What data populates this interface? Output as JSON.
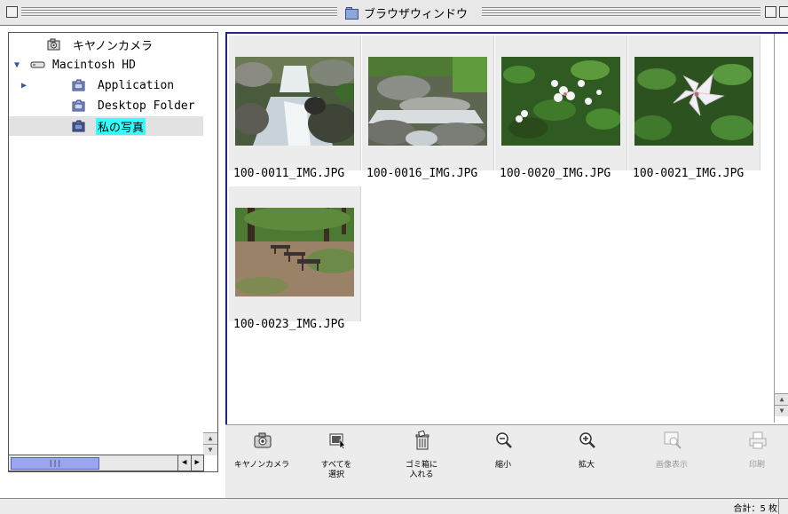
{
  "window": {
    "title": "ブラウザウィンドウ"
  },
  "tree": [
    {
      "label": "キヤノンカメラ",
      "icon": "camera-icon",
      "disclosure": ""
    },
    {
      "label": "Macintosh HD",
      "icon": "harddisk-icon",
      "disclosure": "▼"
    },
    {
      "label": "Application",
      "icon": "folder-icon",
      "disclosure": "▶"
    },
    {
      "label": "Desktop Folder",
      "icon": "folder-icon",
      "disclosure": ""
    },
    {
      "label": "私の写真",
      "icon": "folder-icon",
      "disclosure": "",
      "selected": true
    }
  ],
  "thumbnails": [
    {
      "filename": "100-0011_IMG.JPG",
      "subject": "waterfall stream"
    },
    {
      "filename": "100-0016_IMG.JPG",
      "subject": "stone cascade"
    },
    {
      "filename": "100-0020_IMG.JPG",
      "subject": "white flowers"
    },
    {
      "filename": "100-0021_IMG.JPG",
      "subject": "white lily"
    },
    {
      "filename": "100-0023_IMG.JPG",
      "subject": "park benches"
    }
  ],
  "toolbar": {
    "camera": "キヤノンカメラ",
    "select_all_1": "すべてを",
    "select_all_2": "選択",
    "trash_1": "ゴミ箱に",
    "trash_2": "入れる",
    "zoom_out": "縮小",
    "zoom_in": "拡大",
    "view_image": "画像表示",
    "print": "印刷"
  },
  "status": {
    "count": "合計：5 枚"
  },
  "colors": {
    "selection_highlight": "#33ffff",
    "focus_border": "#23238a",
    "scroll_thumb": "#9aa6f0"
  }
}
